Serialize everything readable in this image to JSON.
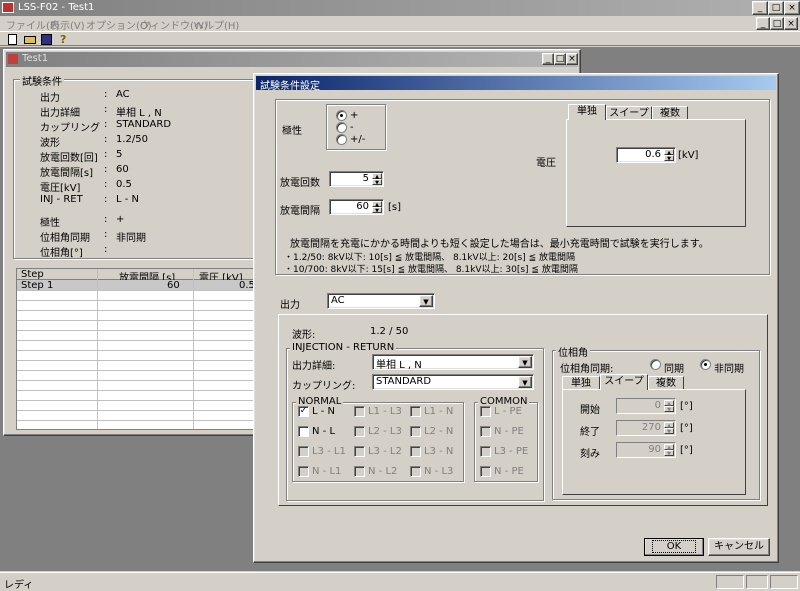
{
  "app": {
    "title": "LSS-F02 - Test1",
    "menu": [
      "ファイル(F)",
      "表示(V)",
      "オプション(O)",
      "ウィンドウ(W)",
      "ヘルプ(H)"
    ],
    "status": "レディ"
  },
  "child": {
    "title": "Test1",
    "group_title": "試験条件",
    "rows": [
      {
        "label": "出力",
        "value": "AC"
      },
      {
        "label": "出力詳細",
        "value": "単相 L , N"
      },
      {
        "label": "カップリング",
        "value": "STANDARD"
      },
      {
        "label": "波形",
        "value": "1.2/50"
      },
      {
        "label": "放電回数[回]",
        "value": "5"
      },
      {
        "label": "放電間隔[s]",
        "value": "60"
      },
      {
        "label": "電圧[kV]",
        "value": "0.5"
      },
      {
        "label": "INJ - RET",
        "value": "L - N"
      },
      {
        "label": "極性",
        "value": "+"
      },
      {
        "label": "位相角同期",
        "value": "非同期"
      },
      {
        "label": "位相角[°]",
        "value": ""
      }
    ],
    "grid": {
      "headers": [
        "Step",
        "放電間隔 [s]",
        "電圧 [kV]"
      ],
      "row": [
        "Step   1",
        "60",
        "0.5"
      ]
    }
  },
  "dialog": {
    "title": "試験条件設定",
    "polarity_label": "極性",
    "polarity_options": [
      "+",
      "-",
      "+/-"
    ],
    "count_label": "放電回数",
    "count_value": "5",
    "interval_label": "放電間隔",
    "interval_value": "60",
    "interval_unit": "[s]",
    "voltage_label": "電圧",
    "voltage_tabs": [
      "単独",
      "スイープ",
      "複数"
    ],
    "voltage_value": "0.6",
    "voltage_unit": "[kV]",
    "note1": "放電間隔を充電にかかる時間よりも短く設定した場合は、最小充電時間で試験を実行します。",
    "note2": "・1.2/50: 8kV以下: 10[s] ≦ 放電間隔、 8.1kV以上: 20[s] ≦ 放電間隔",
    "note3": "・10/700: 8kV以下: 15[s] ≦ 放電間隔、 8.1kV以上: 30[s] ≦ 放電間隔",
    "output_label": "出力",
    "output_value": "AC",
    "waveform_label": "波形:",
    "waveform_value": "1.2 / 50",
    "inj_group": "INJECTION - RETURN",
    "detail_label": "出力詳細:",
    "detail_value": "単相 L , N",
    "coupling_label": "カップリング:",
    "coupling_value": "STANDARD",
    "normal_group": "NORMAL",
    "normal_items": [
      [
        "L - N",
        "L1 - L3",
        "L1 - N"
      ],
      [
        "N - L",
        "L2 - L3",
        "L2 - N"
      ],
      [
        "L3 - L1",
        "L3 - L2",
        "L3 - N"
      ],
      [
        "N - L1",
        "N - L2",
        "N - L3"
      ]
    ],
    "common_group": "COMMON",
    "common_items": [
      "L - PE",
      "N - PE",
      "L3 - PE",
      "N - PE"
    ],
    "phase_group": "位相角",
    "phase_sync_label": "位相角同期:",
    "phase_sync_options": [
      "同期",
      "非同期"
    ],
    "phase_tabs": [
      "単独",
      "スイープ",
      "複数"
    ],
    "phase_fields": [
      {
        "label": "開始",
        "value": "0",
        "unit": "[°]"
      },
      {
        "label": "終了",
        "value": "270",
        "unit": "[°]"
      },
      {
        "label": "刻み",
        "value": "90",
        "unit": "[°]"
      }
    ],
    "ok_label": "OK",
    "cancel_label": "キャンセル"
  }
}
